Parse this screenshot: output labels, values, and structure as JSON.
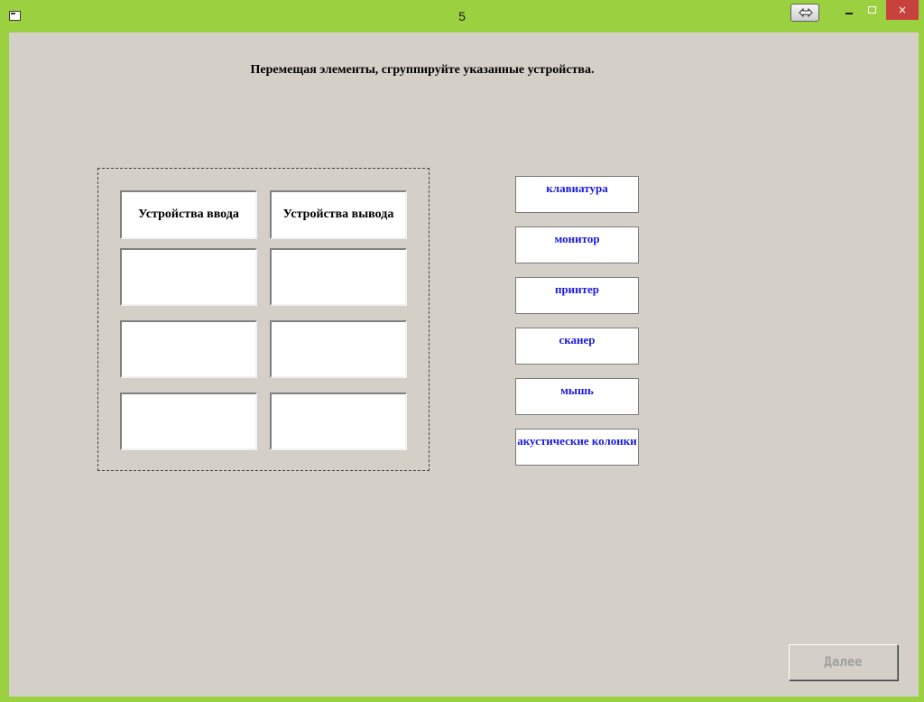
{
  "window": {
    "title": "5",
    "close_glyph": "×"
  },
  "instruction": "Перемещая элементы, сгруппируйте указанные устройства.",
  "columns": {
    "input": "Устройства ввода",
    "output": "Устройства вывода"
  },
  "devices": [
    "клавиатура",
    "монитор",
    "принтер",
    "сканер",
    "мышь",
    "акустические колонки"
  ],
  "buttons": {
    "next": "Далее"
  },
  "colors": {
    "titlebar": "#9bd040",
    "client": "#d4d0c8",
    "device_text": "#1a1adc",
    "close": "#c7423c"
  },
  "icons": [
    "app-icon",
    "restore-icon",
    "minimize-icon",
    "maximize-icon",
    "close-icon"
  ]
}
